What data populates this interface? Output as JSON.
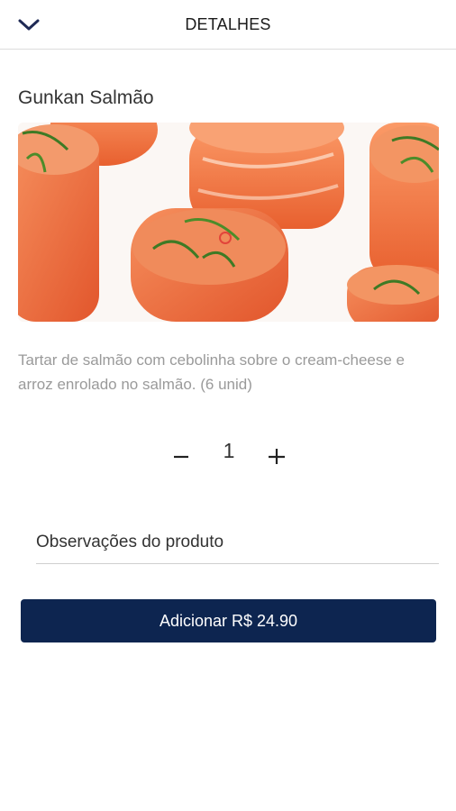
{
  "header": {
    "title": "DETALHES",
    "back_icon": "chevron-down-icon"
  },
  "product": {
    "name": "Gunkan Salmão",
    "image_label": "Gunkan Salmão",
    "description": "Tartar de salmão com cebolinha sobre o cream-cheese e arroz enrolado no salmão. (6 unid)"
  },
  "quantity": {
    "value": "1",
    "decrease_icon": "minus-icon",
    "increase_icon": "plus-icon"
  },
  "notes": {
    "placeholder": "Observações do produto",
    "value": ""
  },
  "action": {
    "add_label": "Adicionar R$ 24.90"
  },
  "colors": {
    "primary": "#0d2550",
    "header_icon": "#1f2a55"
  }
}
